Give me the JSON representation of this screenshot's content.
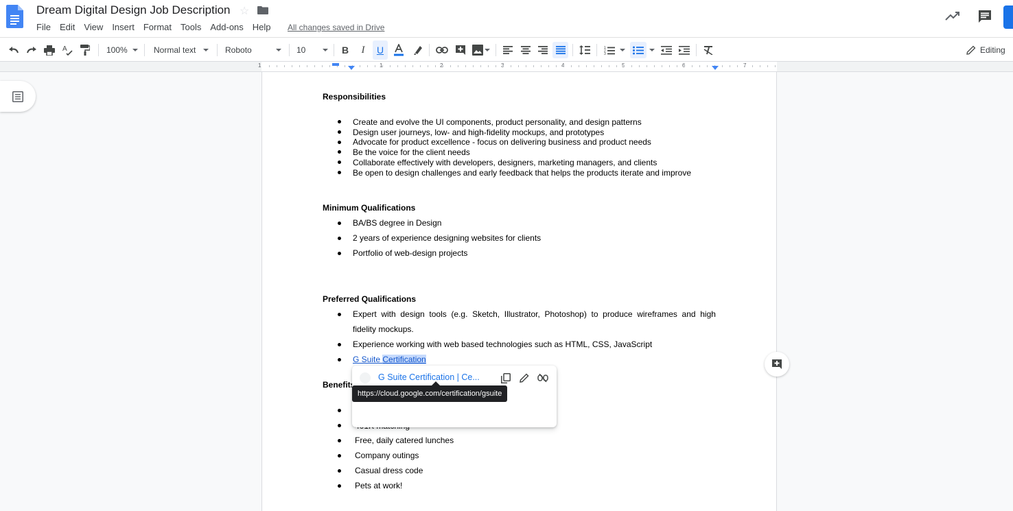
{
  "title_bar": {
    "doc_title": "Dream Digital Design Job Description",
    "saved_status": "All changes saved in Drive",
    "menu": [
      "File",
      "Edit",
      "View",
      "Insert",
      "Format",
      "Tools",
      "Add-ons",
      "Help"
    ]
  },
  "toolbar": {
    "zoom": "100%",
    "style": "Normal text",
    "font": "Roboto",
    "size": "10",
    "mode": "Editing"
  },
  "ruler": {
    "numbers": [
      "1",
      "1",
      "2",
      "3",
      "4",
      "5",
      "6",
      "7"
    ]
  },
  "document": {
    "responsibilities": {
      "heading": "Responsibilities",
      "items": [
        "Create and evolve the UI components, product personality, and design patterns",
        "Design user journeys, low- and high-fidelity mockups, and prototypes",
        "Advocate for product excellence  - focus on delivering business and product needs",
        "Be the voice for the client needs",
        "Collaborate effectively with developers, designers, marketing managers, and clients",
        "Be open to design challenges and early feedback that helps the products iterate and improve"
      ]
    },
    "minimum": {
      "heading": "Minimum Qualifications",
      "items": [
        "BA/BS degree in Design",
        "2 years of experience designing websites for clients",
        "Portfolio of web-design projects"
      ]
    },
    "preferred": {
      "heading": "Preferred Qualifications",
      "item1_line1": "Expert  with  design  tools  (e.g.  Sketch,  Illustrator,  Photoshop)  to  produce  wireframes  and  high",
      "item1_line2": "fidelity mockups.",
      "item2": "Experience working with web based technologies such as HTML, CSS, JavaScript",
      "link_part1": "G Suite ",
      "link_part2": "Certification"
    },
    "benefits": {
      "heading": "Benefits",
      "partial_item": "401K matching",
      "items": [
        "Free, daily catered lunches",
        "Company outings",
        "Casual dress code",
        "Pets at work!"
      ]
    }
  },
  "link_popup": {
    "title": "G Suite Certification | Ce...",
    "url": "https://cloud.google.com/certification/gsuite"
  },
  "colors": {
    "accent": "#1a73e8",
    "link": "#1155cc",
    "selection": "#c6dafc"
  }
}
